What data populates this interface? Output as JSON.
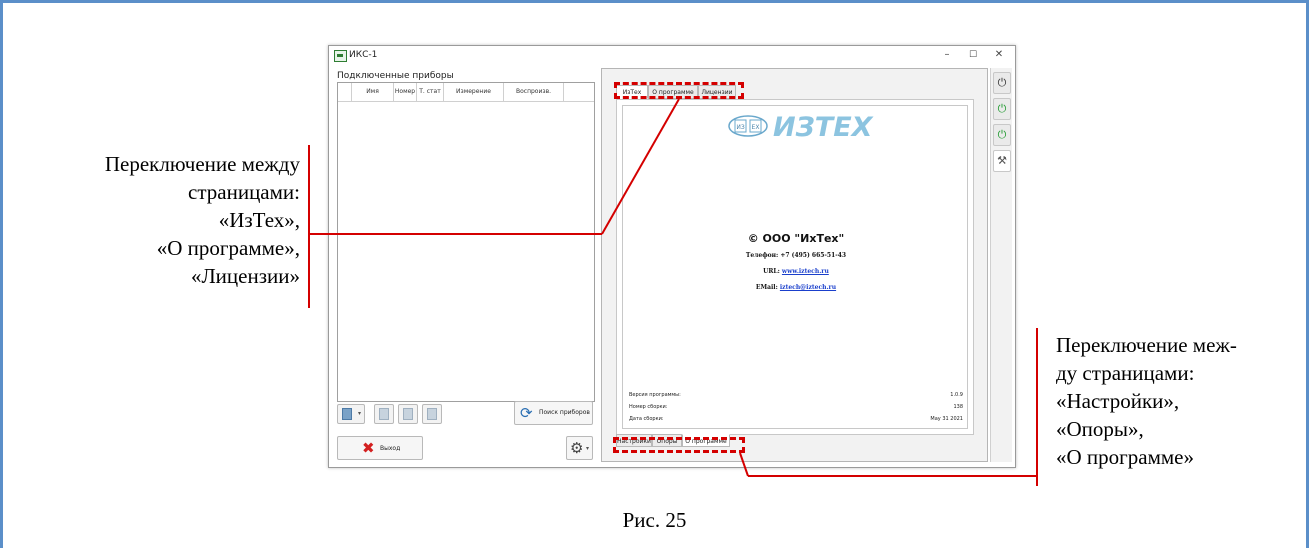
{
  "window": {
    "title": "ИКС-1",
    "controls": {
      "minimize": "–",
      "maximize": "☐",
      "close": "✕"
    }
  },
  "left_panel": {
    "group_title": "Подключенные приборы",
    "columns": [
      "Имя",
      "Номер",
      "Т. стат",
      "Измерение",
      "Воспроизв."
    ],
    "search_button": "Поиск приборов",
    "exit_button": "Выход"
  },
  "right_panel": {
    "top_tabs": [
      "ИзТех",
      "О программе",
      "Лицензии"
    ],
    "selected_top_tab": "ИзТех",
    "logo": {
      "badge": "ИЗ ЕХ",
      "wordmark": "ИЗТЕХ"
    },
    "company": "© ООО \"ИхТех\"",
    "phone": "Телефон: +7 (495) 665-51-43",
    "url_label": "URL:",
    "url": "www.iztech.ru",
    "email_label": "EMail:",
    "email": "iztech@iztech.ru",
    "version_label": "Версия программы:",
    "version": "1.0.9",
    "build_label": "Номер сборки:",
    "build": "138",
    "date_label": "Дата сборки:",
    "date": "May 31 2021",
    "bottom_tabs": [
      "Настройки",
      "Опоры",
      "О программе"
    ],
    "selected_bottom_tab": "О программе"
  },
  "side_strip": {
    "icons": [
      "power-icon",
      "power-green-icon",
      "power-green-icon",
      "tools-icon"
    ]
  },
  "annotations": {
    "left": [
      "Переключение между",
      "страницами:",
      "«ИзТех»,",
      "«О программе»,",
      "«Лицензии»"
    ],
    "right": [
      "Переключение меж-",
      "ду страницами:",
      "«Настройки»,",
      "«Опоры»,",
      "«О программе»"
    ]
  },
  "caption": "Рис. 25",
  "colors": {
    "frame": "#5b8fc9",
    "highlight": "#d40000",
    "logo": "#7fb8d8"
  }
}
